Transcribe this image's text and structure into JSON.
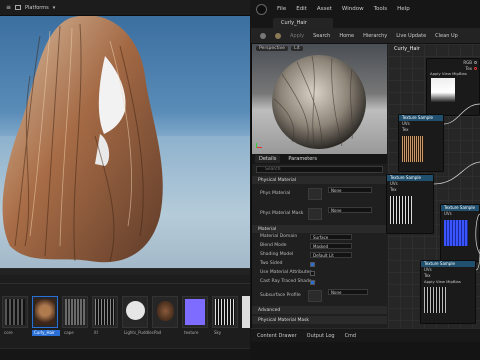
{
  "viewport": {
    "platforms_label": "Platforms"
  },
  "drawer": {
    "items": [
      {
        "label": "core"
      },
      {
        "label": "Curly_Hair"
      },
      {
        "label": "cape"
      },
      {
        "label": "itl"
      },
      {
        "label": "Lights_Puddles"
      },
      {
        "label": "Pad"
      },
      {
        "label": "texture"
      },
      {
        "label": "Sky"
      }
    ]
  },
  "editor": {
    "menus": [
      "File",
      "Edit",
      "Asset",
      "Window",
      "Tools",
      "Help"
    ],
    "tab_title": "Curly_Hair",
    "toolbar": [
      "Save",
      "Browse",
      "Apply",
      "Search",
      "Home",
      "Hierarchy",
      "Live Update",
      "Clean Up"
    ],
    "breadcrumb": "Curly_Hair",
    "preview_tab": "Perspective",
    "preview_lit": "Lit",
    "details_tab": "Details",
    "parameters_tab": "Parameters",
    "search_placeholder": "Search",
    "sections": {
      "physical": "Physical Material",
      "material": "Material",
      "advanced": "Advanced",
      "physical_mask": "Physical Material Mask"
    },
    "props": {
      "phys_material": {
        "label": "Phys Material",
        "value": "None"
      },
      "phys_material_mask": {
        "label": "Phys Material Mask",
        "value": "None"
      },
      "material_domain": {
        "label": "Material Domain",
        "value": "Surface"
      },
      "blend_mode": {
        "label": "Blend Mode",
        "value": "Masked"
      },
      "shading_model": {
        "label": "Shading Model",
        "value": "Default Lit"
      },
      "two_sided": {
        "label": "Two Sided"
      },
      "use_material_attributes": {
        "label": "Use Material Attributes"
      },
      "cast_ray_traced_shadows": {
        "label": "Cast Ray Traced Shado..."
      },
      "subsurface_profile": {
        "label": "Subsurface Profile",
        "value": "None"
      }
    },
    "graph": {
      "nodes": [
        {
          "title": "Texture Sample",
          "pins": [
            "UVs",
            "Tex",
            "Apply View MipBias"
          ]
        },
        {
          "title": "Texture Sample",
          "pins": [
            "UVs",
            "Tex",
            "Apply View MipBias"
          ]
        },
        {
          "title": "Texture Sample",
          "pins": [
            "UVs",
            "Tex",
            "Apply View MipBias"
          ]
        },
        {
          "title": "Texture Sample",
          "pins": [
            "UVs",
            "Tex",
            "Apply View MipBias"
          ]
        }
      ],
      "outputs": [
        "RGB",
        "R",
        "G",
        "B",
        "A",
        "RGBA"
      ]
    },
    "status": {
      "content_drawer": "Content Drawer",
      "output_log": "Output Log",
      "cmd": "Cmd"
    }
  },
  "colors": {
    "accent_blue": "#2a6fd6",
    "node_header": "#20506e",
    "mask_blue": "#3a55ff"
  }
}
